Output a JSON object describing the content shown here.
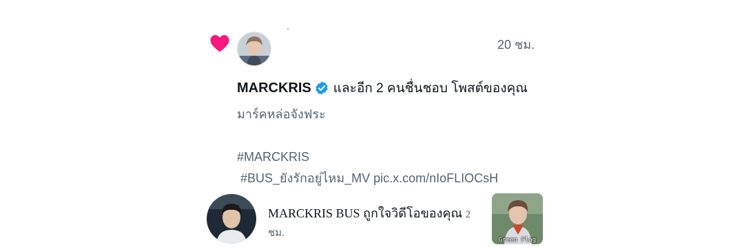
{
  "notification_like_post": {
    "time": "20 ชม.",
    "user_name": "MARCKRIS",
    "action_text": "และอีก 2 คนชื่นชอบ โพสต์ของคุณ",
    "tweet_line1": "มาร์คหล่อจังฟระ",
    "hashtag1": "#MARCKRIS",
    "hashtag2_line": "#BUS_ยังรักอยู่ไหม_MV pic.x.com/nIoFLIOCsH",
    "icons": {
      "like": "heart-icon",
      "verified": "verified-badge-icon"
    },
    "colors": {
      "heart": "#f91880",
      "verified": "#1d9bf0",
      "secondary_text": "#536471"
    }
  },
  "notification_like_video": {
    "text": "MARCKRIS BUS ถูกใจวิดีโอของคุณ",
    "time": "2 ชม.",
    "thumbnail_caption": "Green Flag"
  }
}
